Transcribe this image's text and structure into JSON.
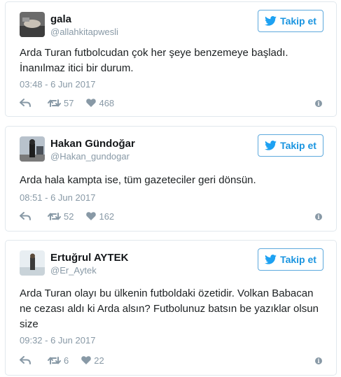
{
  "follow_label": "Takip et",
  "colors": {
    "accent": "#1b95e0",
    "meta": "#8899a6",
    "border": "#e1e8ed"
  },
  "tweets": [
    {
      "name": "gala",
      "handle": "@allahkitapwesli",
      "text": [
        "Arda Turan futbolcudan çok her şeye benzemeye başladı.",
        "İnanılmaz itici bir durum."
      ],
      "time": "03:48 - 6 Jun 2017",
      "retweets": "57",
      "likes": "468"
    },
    {
      "name": "Hakan Gündoğar",
      "handle": "@Hakan_gundogar",
      "text": [
        "Arda hala kampta ise, tüm gazeteciler geri dönsün."
      ],
      "time": "08:51 - 6 Jun 2017",
      "retweets": "52",
      "likes": "162"
    },
    {
      "name": "Ertuğrul AYTEK",
      "handle": "@Er_Aytek",
      "text": [
        "Arda Turan olayı bu ülkenin futboldaki özetidir. Volkan Babacan",
        "ne cezası aldı ki Arda alsın? Futbolunuz batsın be yazıklar olsun",
        "size"
      ],
      "time": "09:32 - 6 Jun 2017",
      "retweets": "6",
      "likes": "22"
    }
  ]
}
